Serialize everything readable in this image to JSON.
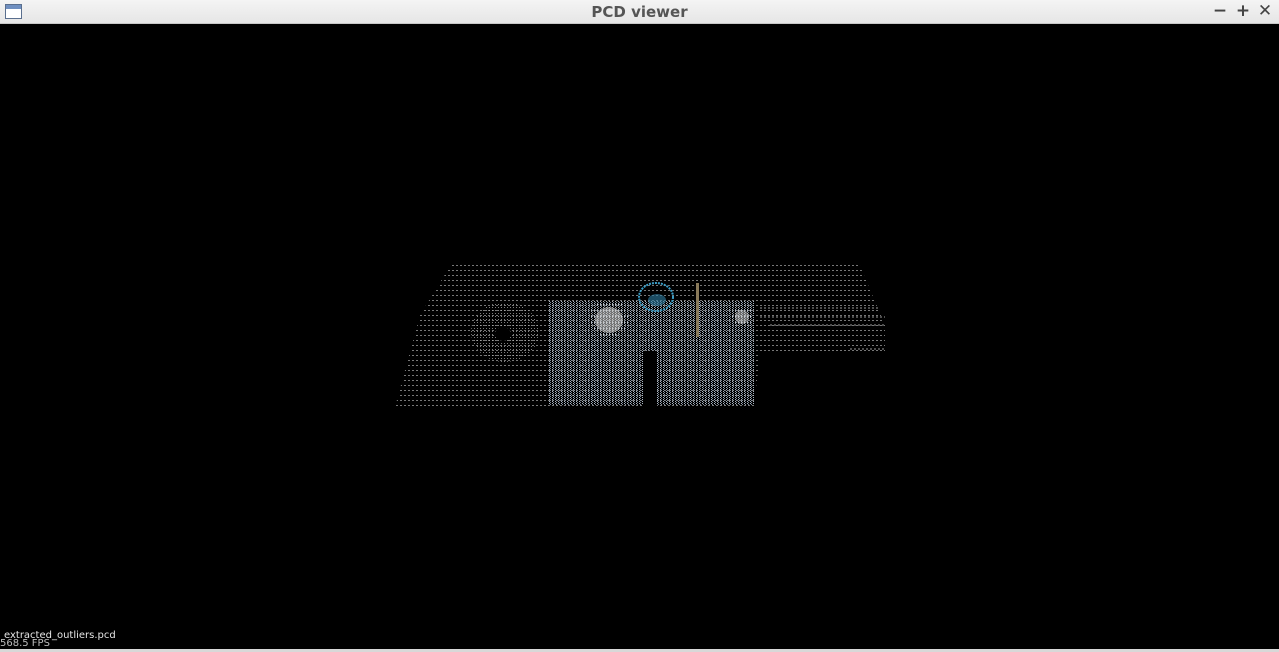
{
  "window": {
    "title": "PCD viewer",
    "minimize_glyph": "−",
    "maximize_glyph": "+",
    "close_glyph": "✕",
    "app_icon": "window-icon"
  },
  "viewer": {
    "background_color": "#000000",
    "filename": "extracted_outliers.pcd",
    "fps": "568.5 FPS"
  },
  "colors": {
    "points_gray": "#9a9a9a",
    "points_light": "#d8d8d8",
    "points_blue": "#3a9ec8",
    "points_tan": "#8a7a5a"
  }
}
